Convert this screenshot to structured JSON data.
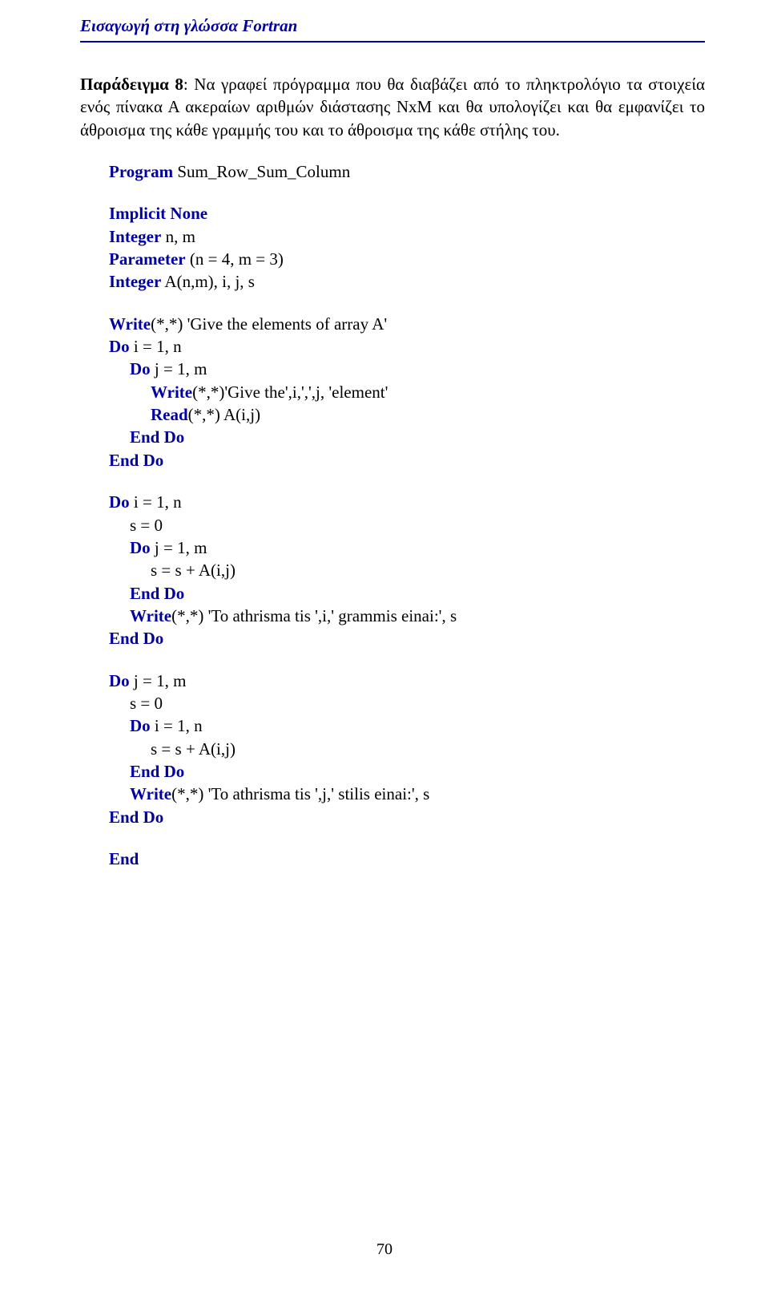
{
  "header": "Εισαγωγή στη γλώσσα Fortran",
  "p1_a": "Παράδειγμα 8",
  "p1_b": ": Να γραφεί πρόγραμμα που θα διαβάζει από το πληκτρολόγιο τα στοιχεία ενός πίνακα Α ακεραίων αριθμών διάστασης NxM και θα υπολογίζει και θα εμφανίζει το άθροισμα της κάθε γραμμής του και το άθροισμα της κάθε στήλης του.",
  "l1a": "Program",
  "l1b": " Sum_Row_Sum_Column",
  "l2": "Implicit None",
  "l3a": "Integer",
  "l3b": " n, m",
  "l4a": "Parameter",
  "l4b": " (n = 4, m = 3)",
  "l5a": "Integer",
  "l5b": " A(n,m), i, j, s",
  "l6a": "Write",
  "l6b": "(*,*) 'Give the elements of array A'",
  "l7a": "Do",
  "l7b": " i = 1, n",
  "l8a": "Do",
  "l8b": " j = 1, m",
  "l9a": "Write",
  "l9b": "(*,*)'Give the',i,',',j, 'element'",
  "l10a": "Read",
  "l10b": "(*,*) A(i,j)",
  "l11": "End Do",
  "l12": "End Do",
  "l13a": "Do",
  "l13b": " i = 1, n",
  "l14": "s = 0",
  "l15a": "Do",
  "l15b": " j = 1, m",
  "l16": "s = s + A(i,j)",
  "l17": "End Do",
  "l18a": "Write",
  "l18b": "(*,*) 'To athrisma tis ',i,' grammis einai:', s",
  "l19": "End Do",
  "l20a": "Do",
  "l20b": " j = 1, m",
  "l21": "s = 0",
  "l22a": "Do",
  "l22b": " i = 1, n",
  "l23": "s = s + A(i,j)",
  "l24": "End Do",
  "l25a": "Write",
  "l25b": "(*,*) 'To athrisma tis ',j,' stilis einai:', s",
  "l26": "End Do",
  "l27": "End",
  "page_number": "70"
}
